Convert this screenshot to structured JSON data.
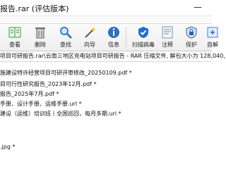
{
  "window": {
    "title": "报告.rar (评估版本)",
    "minimize_glyph": "—"
  },
  "toolbar": {
    "items": [
      {
        "label": "查看",
        "icon": "view-book-icon",
        "color": "#3a9a4a"
      },
      {
        "label": "删除",
        "icon": "delete-icon",
        "color": "#6a6a6a"
      },
      {
        "label": "查找",
        "icon": "find-icon",
        "color": "#3b79c9"
      },
      {
        "label": "向导",
        "icon": "wizard-icon",
        "color": "#8a8a8a"
      },
      {
        "label": "信息",
        "icon": "info-icon",
        "color": "#2f6fc0"
      },
      {
        "label": "扫描病毒",
        "icon": "virus-scan-icon",
        "color": "#1f6fcf"
      },
      {
        "label": "注释",
        "icon": "comment-icon",
        "color": "#7a8fb3"
      },
      {
        "label": "保护",
        "icon": "protect-icon",
        "color": "#2a5fb0"
      },
      {
        "label": "自解",
        "icon": "sfx-icon",
        "color": "#4e7fc9"
      }
    ]
  },
  "pathbar": {
    "text": "项目可研报告.rar\\云南三地区充电站项目可研报告 - RAR 压缩文件, 解包大小为 128,040,"
  },
  "files": [
    "施建设特许经营项目可研评审修改_20250109.pdf *",
    "目可行性研究报告_2023年12月.pdf *",
    "报告_2025年7月.pdf *",
    "手册、设计手册、运维手册.url *",
    "建设（运维）培训班丨全国巡回，每月多期.url *",
    ".jpg *"
  ]
}
